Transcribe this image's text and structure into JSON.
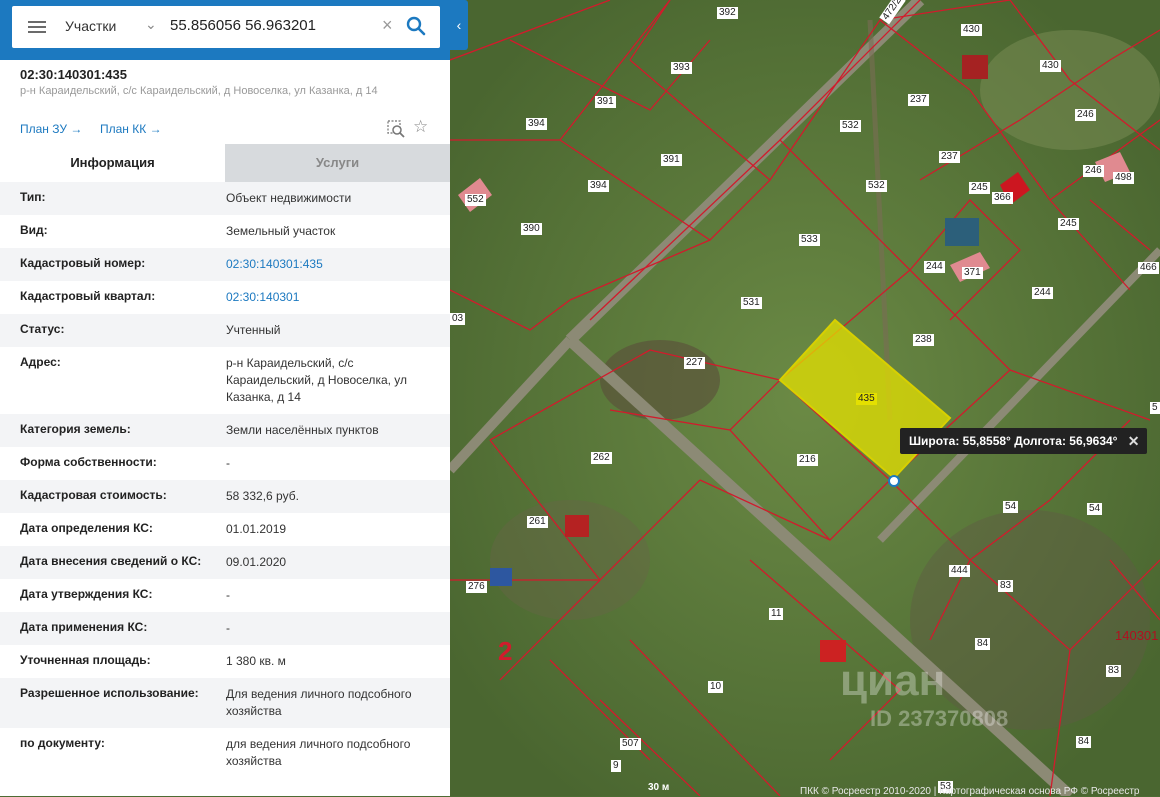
{
  "search": {
    "layer_label": "Участки",
    "query": "55.856056 56.963201"
  },
  "object": {
    "cadastral_title": "02:30:140301:435",
    "address_short": "р-н Караидельский, с/с Караидельский, д Новоселка, ул Казанка, д 14",
    "plan_zu": "План ЗУ →",
    "plan_kk": "План КК →"
  },
  "tabs": {
    "info": "Информация",
    "services": "Услуги"
  },
  "rows": [
    {
      "label": "Тип:",
      "value": "Объект недвижимости"
    },
    {
      "label": "Вид:",
      "value": "Земельный участок"
    },
    {
      "label": "Кадастровый номер:",
      "value": "02:30:140301:435"
    },
    {
      "label": "Кадастровый квартал:",
      "value": "02:30:140301"
    },
    {
      "label": "Статус:",
      "value": "Учтенный"
    },
    {
      "label": "Адрес:",
      "value": "р-н Караидельский, с/с Караидельский, д Новоселка, ул Казанка, д 14"
    },
    {
      "label": "Категория земель:",
      "value": "Земли населённых пунктов"
    },
    {
      "label": "Форма собственности:",
      "value": "-"
    },
    {
      "label": "Кадастровая стоимость:",
      "value": "58 332,6 руб."
    },
    {
      "label": "Дата определения КС:",
      "value": "01.01.2019"
    },
    {
      "label": "Дата внесения сведений о КС:",
      "value": "09.01.2020"
    },
    {
      "label": "Дата утверждения КС:",
      "value": "-"
    },
    {
      "label": "Дата применения КС:",
      "value": "-"
    },
    {
      "label": "Уточненная площадь:",
      "value": "1 380 кв. м"
    },
    {
      "label": "Разрешенное использование:",
      "value": "Для ведения личного подсобного хозяйства"
    },
    {
      "label": "по документу:",
      "value": "для ведения личного подсобного хозяйства"
    }
  ],
  "map": {
    "coord_popup": "Широта: 55,8558° Долгота: 56,9634°",
    "quarter_number": "2",
    "quarter_code": "140301",
    "watermark": "циан",
    "watermark_id": "ID 237370808",
    "scale": "30 м",
    "copyright": "ПКК © Росреестр 2010-2020 | Картографическая основа РФ © Росреестр",
    "road_label": "472/2",
    "parcels": [
      "392",
      "430",
      "430",
      "393",
      "391",
      "237",
      "246",
      "394",
      "532",
      "391",
      "237",
      "245",
      "246",
      "498",
      "394",
      "532",
      "366",
      "245",
      "552",
      "390",
      "533",
      "244",
      "371",
      "244",
      "466",
      "531",
      "238",
      "227",
      "435",
      "216",
      "262",
      "54",
      "54",
      "261",
      "444",
      "276",
      "11",
      "83",
      "84",
      "140301",
      "83",
      "10",
      "507",
      "9",
      "84",
      "53",
      "03",
      "5"
    ]
  },
  "colors": {
    "accent": "#1c79c0",
    "parcel_line": "#d11b2c",
    "selected_parcel": "#e4e000"
  }
}
